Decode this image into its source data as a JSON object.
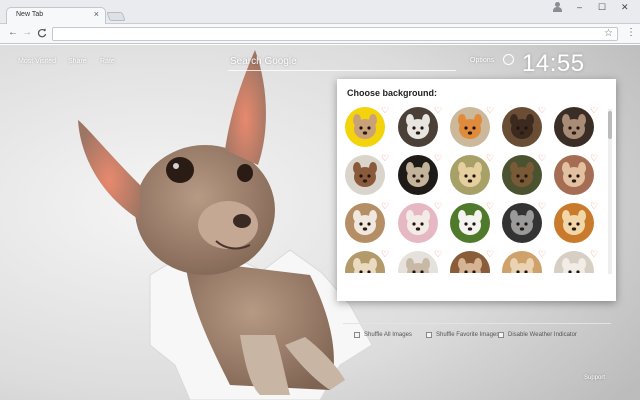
{
  "browser": {
    "tab_title": "New Tab",
    "tab_close": "×",
    "window_controls": {
      "minimize": "–",
      "maximize": "☐",
      "close": "✕"
    },
    "nav": {
      "back": "←",
      "forward": "→",
      "reload": "C"
    },
    "address_value": "",
    "star": "☆",
    "menu": "⋮"
  },
  "newtab": {
    "top_links": [
      "Most Visited",
      "Share",
      "Rate"
    ],
    "search_placeholder": "Search Google",
    "options_label": "Options",
    "weather_icon": "weather-icon",
    "clock": "14:55",
    "support_label": "Support"
  },
  "background_panel": {
    "title": "Choose background:",
    "heart_glyph": "♡",
    "thumbnails": [
      {
        "row": 0,
        "col": 0,
        "subject": "chihuahua-yellow-background",
        "bg": "#f3d30b",
        "fg": "#c8a17a"
      },
      {
        "row": 0,
        "col": 1,
        "subject": "dog-with-toy",
        "bg": "#4a4038",
        "fg": "#e8e4df"
      },
      {
        "row": 0,
        "col": 2,
        "subject": "puppy-toy-colorful",
        "bg": "#ccb89a",
        "fg": "#e08a3c"
      },
      {
        "row": 0,
        "col": 3,
        "subject": "puppy-on-wood",
        "bg": "#6a4d35",
        "fg": "#3b2a1d"
      },
      {
        "row": 0,
        "col": 4,
        "subject": "dark-puppy",
        "bg": "#3a2d26",
        "fg": "#a98c76"
      },
      {
        "row": 1,
        "col": 0,
        "subject": "puppy-white-bg",
        "bg": "#d9d4cc",
        "fg": "#8b5a3b"
      },
      {
        "row": 1,
        "col": 1,
        "subject": "pug-dark",
        "bg": "#1e1a17",
        "fg": "#c3b39b"
      },
      {
        "row": 1,
        "col": 2,
        "subject": "pug-grass",
        "bg": "#a7a067",
        "fg": "#e6cf9f"
      },
      {
        "row": 1,
        "col": 3,
        "subject": "dogs-on-log",
        "bg": "#4a5230",
        "fg": "#7a5a36"
      },
      {
        "row": 1,
        "col": 4,
        "subject": "puppies-basket",
        "bg": "#a56d54",
        "fg": "#e3c1a0"
      },
      {
        "row": 2,
        "col": 0,
        "subject": "puppy-doorway",
        "bg": "#b58e66",
        "fg": "#f0e8de"
      },
      {
        "row": 2,
        "col": 1,
        "subject": "puppies-pink",
        "bg": "#e6b8c3",
        "fg": "#f3ece6"
      },
      {
        "row": 2,
        "col": 2,
        "subject": "puppies-grass",
        "bg": "#4f7a2c",
        "fg": "#f5f3ef"
      },
      {
        "row": 2,
        "col": 3,
        "subject": "dog-bw",
        "bg": "#333333",
        "fg": "#9a9a9a"
      },
      {
        "row": 2,
        "col": 4,
        "subject": "puppy-autumn",
        "bg": "#c97a2a",
        "fg": "#f1d7a8"
      },
      {
        "row": 3,
        "col": 0,
        "subject": "puppy-field",
        "bg": "#b29a6a",
        "fg": "#eadac0"
      },
      {
        "row": 3,
        "col": 1,
        "subject": "puppy-white",
        "bg": "#e5e1dc",
        "fg": "#c8b8a6"
      },
      {
        "row": 3,
        "col": 2,
        "subject": "puppy-brown",
        "bg": "#8a5d3a",
        "fg": "#d6b392"
      },
      {
        "row": 3,
        "col": 3,
        "subject": "puppy-tan",
        "bg": "#cfa26b",
        "fg": "#e9d3b3"
      },
      {
        "row": 3,
        "col": 4,
        "subject": "puppy-light",
        "bg": "#d8cfc4",
        "fg": "#f1ece6"
      }
    ],
    "options": [
      {
        "label": "Shuffle All Images",
        "checked": false
      },
      {
        "label": "Shuffle Favorite Images",
        "checked": false
      },
      {
        "label": "Disable Weather Indicator",
        "checked": false
      }
    ]
  },
  "colors": {
    "heart": "#f2846a",
    "panel_bg": "#ffffff",
    "overlay_text": "#ffffff",
    "chrome_bg": "#e9ebee"
  }
}
